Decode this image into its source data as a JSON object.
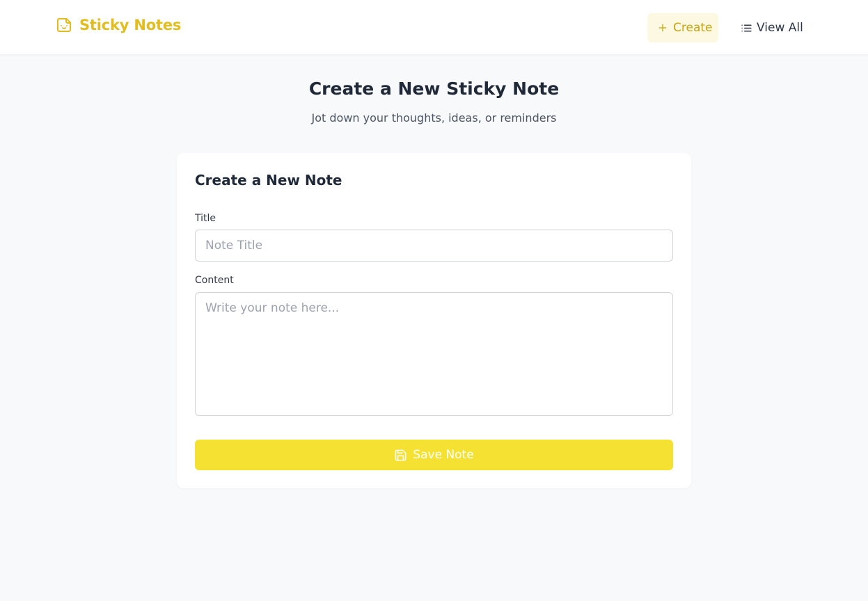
{
  "header": {
    "brand_title": "Sticky Notes",
    "brand_icon": "sticky-note-smile-icon",
    "nav": {
      "create_label": "Create",
      "create_icon": "plus-icon",
      "view_all_label": "View All",
      "view_all_icon": "list-icon"
    }
  },
  "page": {
    "title": "Create a New Sticky Note",
    "subtitle": "Jot down your thoughts, ideas, or reminders"
  },
  "form": {
    "heading": "Create a New Note",
    "title_label": "Title",
    "title_placeholder": "Note Title",
    "title_value": "",
    "content_label": "Content",
    "content_placeholder": "Write your note here...",
    "content_value": "",
    "save_label": "Save Note",
    "save_icon": "save-icon"
  },
  "colors": {
    "brand": "#e2bd1f",
    "nav_active_bg": "#fdf8e1",
    "nav_active_text": "#c9a40e",
    "save_button": "#f5e132",
    "page_background": "#f8f9fb"
  }
}
